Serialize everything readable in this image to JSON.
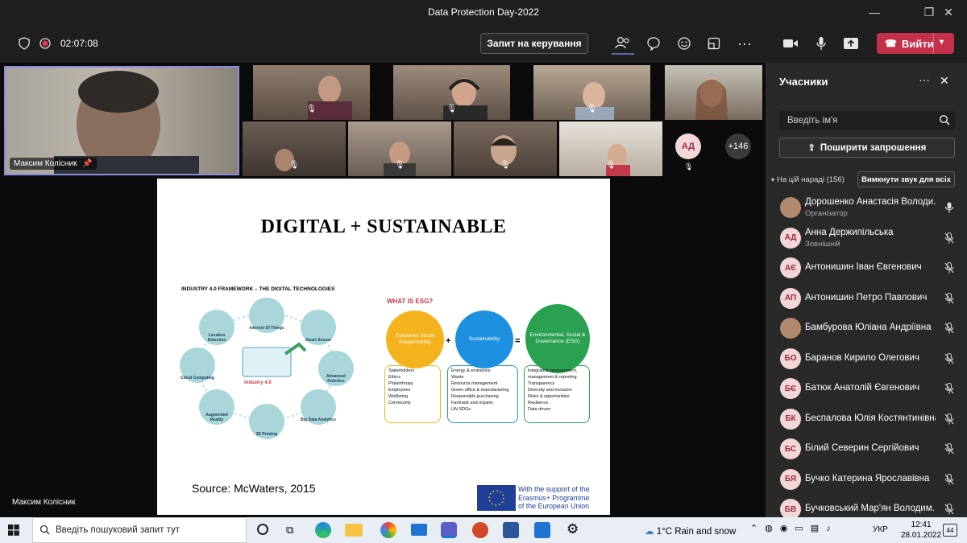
{
  "window": {
    "title": "Data Protection Day-2022"
  },
  "toolbar": {
    "timer": "02:07:08",
    "request_control": "Запит на керування",
    "leave": "Вийти"
  },
  "main_speaker": {
    "name": "Максим Колісник"
  },
  "stage_footer": {
    "presenter": "Максим Колісник"
  },
  "overflow": {
    "avatar_initials": "АД",
    "more_count": "+146"
  },
  "slide": {
    "title": "DIGITAL + SUSTAINABLE",
    "framework_title": "INDUSTRY 4.0 FRAMEWORK – THE DIGITAL TECHNOLOGIES",
    "center_label": "Industry 4.0",
    "nodes": [
      "Internet Of Things",
      "Smart Sensor",
      "Advanced Robotics",
      "Big Data Analytics",
      "3D Printing",
      "Augmented Reality",
      "Cloud Computing",
      "Location Detection"
    ],
    "esg_heading": "WHAT IS ESG?",
    "csr": "Corporate Social Responsibility",
    "sust": "Sustainability",
    "esg": "Environmental, Social & Governance (ESG)",
    "plus": "+",
    "equals": "=",
    "csr_items": [
      "Stakeholders",
      "Ethics",
      "Philanthropy",
      "Employees",
      "Wellbeing",
      "Community"
    ],
    "sust_items": [
      "Energy & emissions",
      "Waste",
      "Resource management",
      "Green office & manufacturing",
      "Responsible purchasing",
      "Fairtrade and organic",
      "UN SDGs"
    ],
    "esg_items": [
      "Integrated measurement,",
      "management & reporting",
      "Transparency",
      "Diversity and inclusion",
      "Risks & opportunities",
      "Resilience",
      "Data driven"
    ],
    "source": "Source: McWaters, 2015",
    "eu_text": [
      "With the support of the",
      "Erasmus+ Programme",
      "of the European Union"
    ]
  },
  "panel": {
    "title": "Учасники",
    "search_placeholder": "Введіть ім'я",
    "share_invite": "Поширити запрошення",
    "section_label": "На цій нараді (156)",
    "mute_all": "Вимкнути звук для всіх",
    "participants": [
      {
        "initials": "",
        "name": "Дорошенко Анастасія Володи...",
        "role": "Організатор",
        "mic": "on"
      },
      {
        "initials": "АД",
        "name": "Анна Держипільська",
        "role": "Зовнішній",
        "mic": "off"
      },
      {
        "initials": "АЄ",
        "name": "Антонишин Іван Євгенович",
        "role": "",
        "mic": "off"
      },
      {
        "initials": "АП",
        "name": "Антонишин Петро Павлович",
        "role": "",
        "mic": "off"
      },
      {
        "initials": "",
        "name": "Бамбурова Юліана Андріївна",
        "role": "",
        "mic": "off"
      },
      {
        "initials": "БО",
        "name": "Баранов Кирило Олегович",
        "role": "",
        "mic": "off"
      },
      {
        "initials": "БЄ",
        "name": "Батюк Анатолій Євгенович",
        "role": "",
        "mic": "off"
      },
      {
        "initials": "БК",
        "name": "Беспалова Юлія Костянтинівна",
        "role": "",
        "mic": "off"
      },
      {
        "initials": "БС",
        "name": "Білий Северин Сергійович",
        "role": "",
        "mic": "off"
      },
      {
        "initials": "БЯ",
        "name": "Бучко Катерина Ярославівна",
        "role": "",
        "mic": "off"
      },
      {
        "initials": "БВ",
        "name": "Бучковський Мар'ян Володим...",
        "role": "",
        "mic": "off"
      }
    ]
  },
  "taskbar": {
    "search_placeholder": "Введіть пошуковий запит тут",
    "weather": "1°C  Rain and snow",
    "lang": "УКР",
    "time": "12:41",
    "date": "28.01.2022",
    "notif_count": "44"
  },
  "colors": {
    "accent": "#6264a7",
    "leave": "#c4314b",
    "csr": "#f4b21c",
    "sust": "#1e90e0",
    "esg": "#2aa150"
  }
}
